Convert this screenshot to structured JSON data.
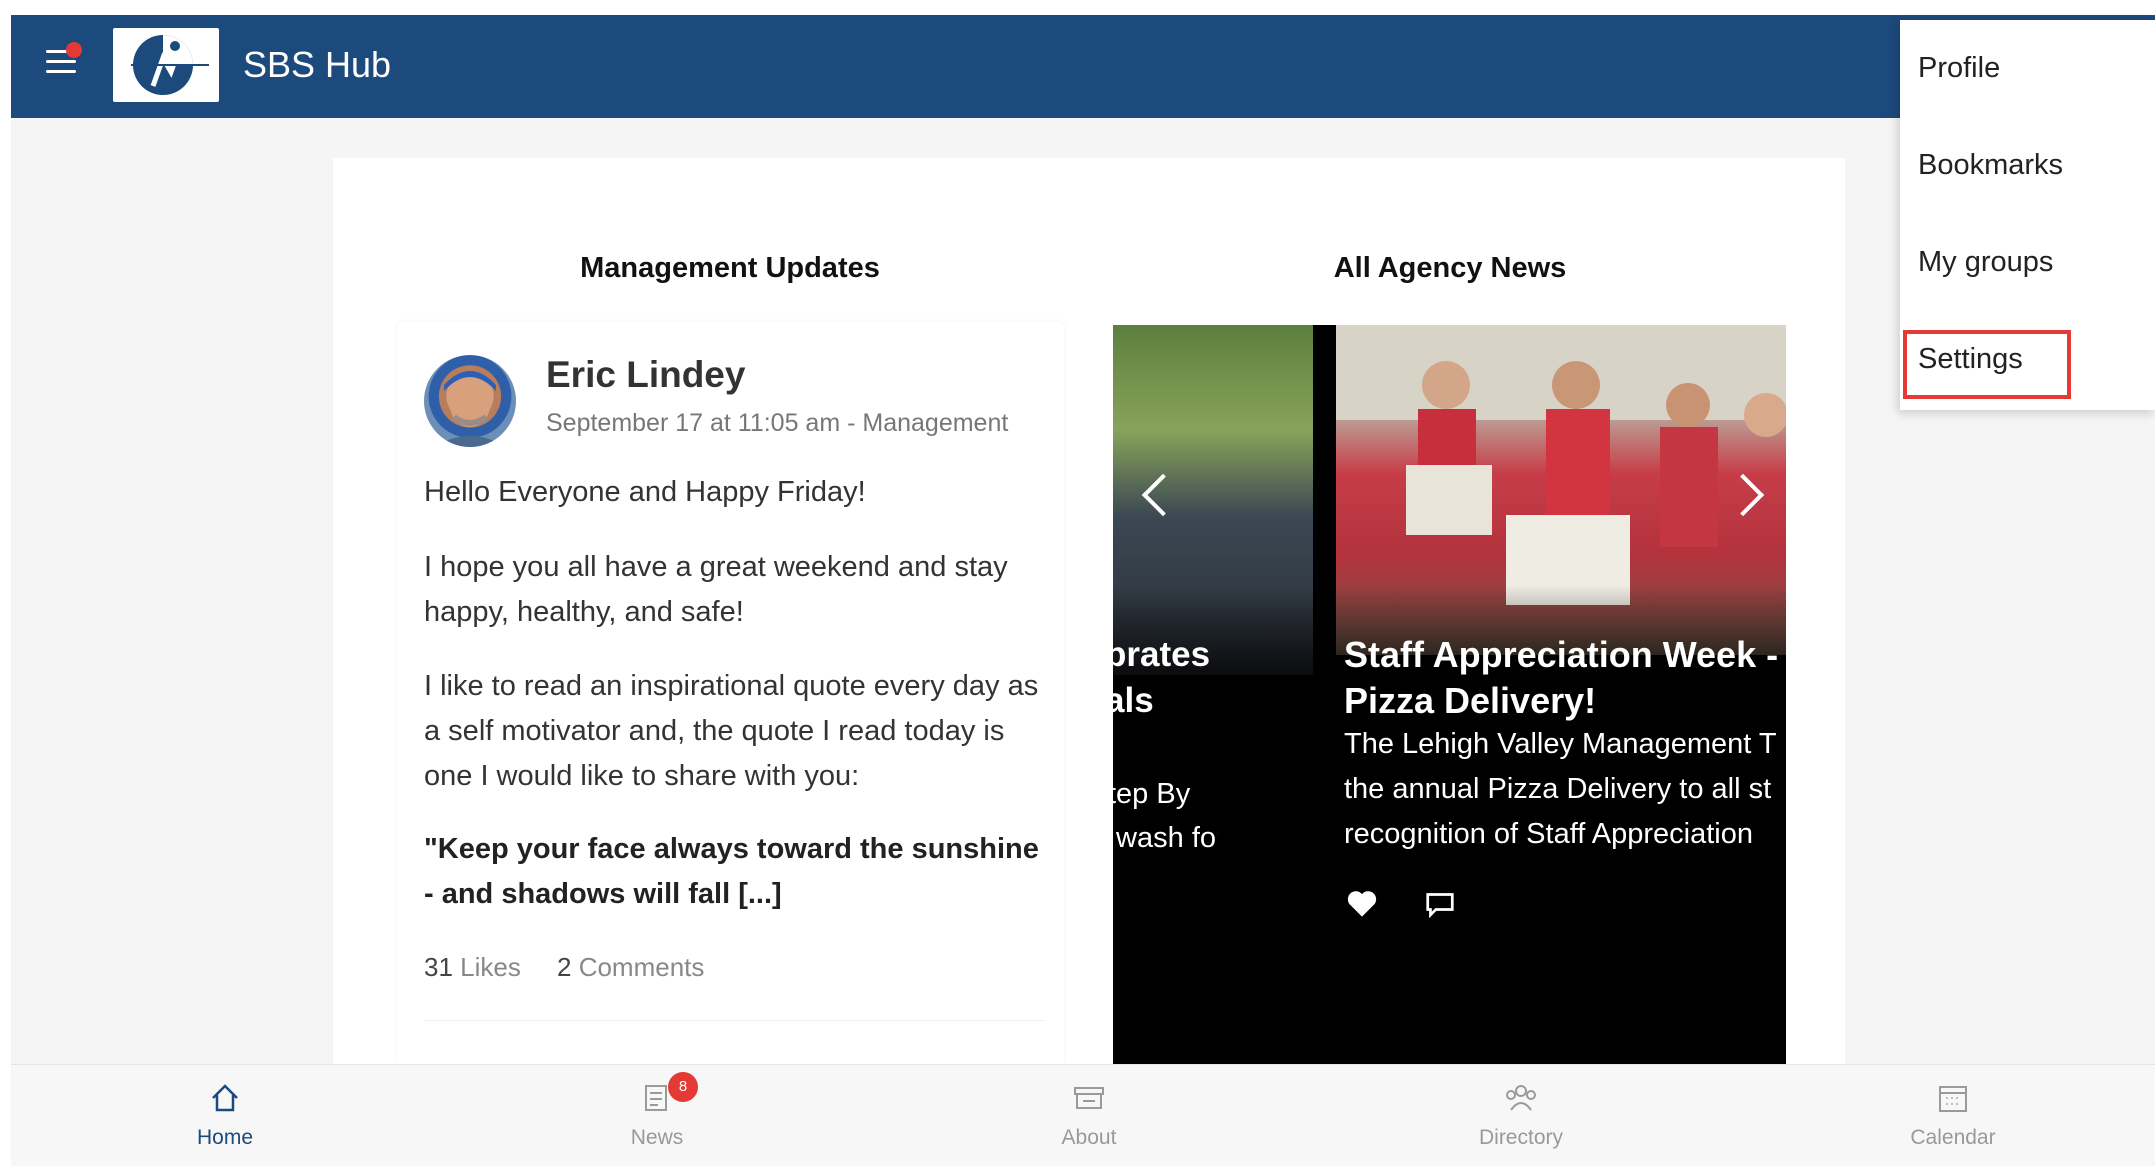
{
  "header": {
    "title": "SBS Hub",
    "brand_color": "#1c4a7c"
  },
  "sections": {
    "left_title": "Management Updates",
    "right_title": "All Agency News"
  },
  "post": {
    "author": "Eric Lindey",
    "meta": "September 17 at 11:05 am - Management",
    "paragraphs": [
      "Hello Everyone and Happy Friday!",
      "I hope you all have a great weekend and stay happy, healthy, and safe!",
      "I like to read an inspirational quote every day as a self motivator and, the quote I read today is one I would like to share with you:",
      "\"Keep your face always toward the sunshine - and shadows will fall [...]"
    ],
    "likes_count": "31",
    "likes_label": "Likes",
    "comments_count": "2",
    "comments_label": "Comments"
  },
  "news": {
    "prev_title": "brates\nals",
    "prev_text": "tep By\n wash for",
    "current_title_line1": "Staff Appreciation Week -",
    "current_title_line2": "Pizza Delivery!",
    "current_text_line1": "The Lehigh Valley Management T",
    "current_text_line2": "the annual Pizza Delivery to all st",
    "current_text_line3": "recognition of Staff Appreciation"
  },
  "bottom_nav": [
    {
      "label": "Home",
      "icon": "home-icon",
      "active": true
    },
    {
      "label": "News",
      "icon": "news-icon",
      "badge": "8"
    },
    {
      "label": "About",
      "icon": "about-icon"
    },
    {
      "label": "Directory",
      "icon": "directory-icon"
    },
    {
      "label": "Calendar",
      "icon": "calendar-icon"
    }
  ],
  "menu": {
    "items": [
      "Profile",
      "Bookmarks",
      "My groups",
      "Settings"
    ],
    "highlighted": "Settings",
    "highlight_color": "#e53935"
  }
}
